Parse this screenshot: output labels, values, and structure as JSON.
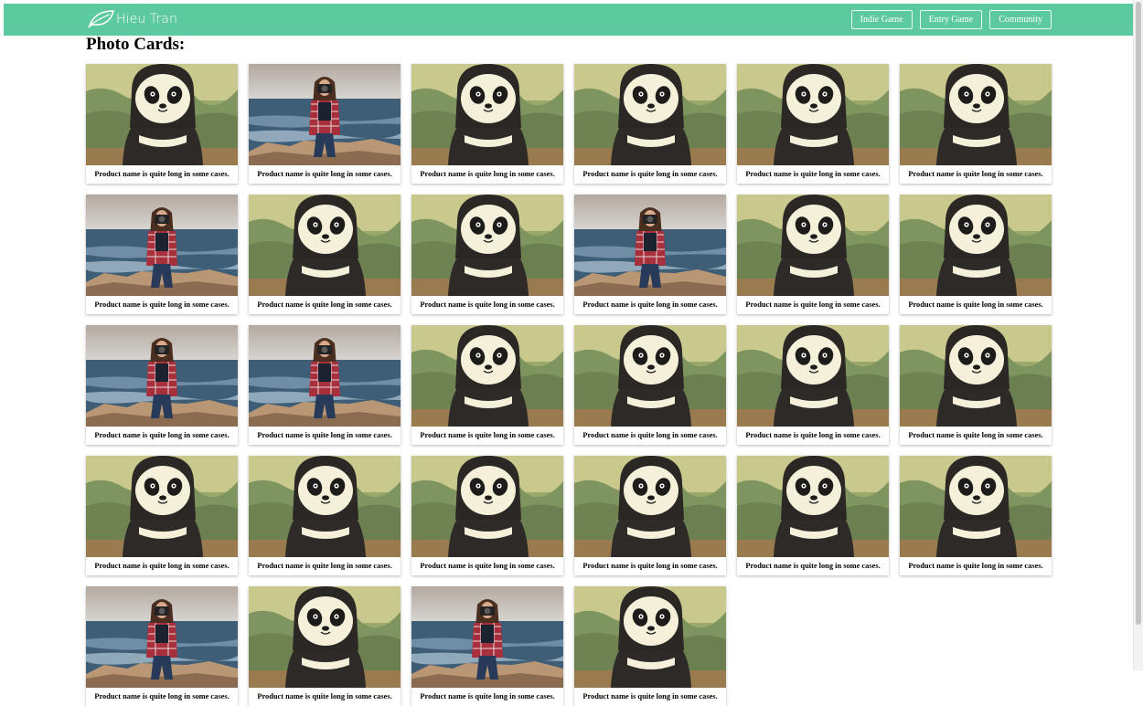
{
  "brand": {
    "name": "Hieu Tran",
    "icon": "leaf-icon"
  },
  "nav": {
    "items": [
      {
        "label": "Indie Game"
      },
      {
        "label": "Entry Game"
      },
      {
        "label": "Community"
      }
    ]
  },
  "page": {
    "title": "Photo Cards:"
  },
  "colors": {
    "navbar": "#5cc99f",
    "card_shadow": "#cccccc"
  },
  "cards": [
    {
      "image": "panda-painting",
      "caption": "Product name is quite long in some cases."
    },
    {
      "image": "girl-with-camera-by-sea",
      "caption": "Product name is quite long in some cases."
    },
    {
      "image": "panda-painting",
      "caption": "Product name is quite long in some cases."
    },
    {
      "image": "panda-painting",
      "caption": "Product name is quite long in some cases."
    },
    {
      "image": "panda-painting",
      "caption": "Product name is quite long in some cases."
    },
    {
      "image": "panda-painting",
      "caption": "Product name is quite long in some cases."
    },
    {
      "image": "girl-with-camera-by-sea",
      "caption": "Product name is quite long in some cases."
    },
    {
      "image": "panda-painting",
      "caption": "Product name is quite long in some cases."
    },
    {
      "image": "panda-painting",
      "caption": "Product name is quite long in some cases."
    },
    {
      "image": "girl-with-camera-by-sea",
      "caption": "Product name is quite long in some cases."
    },
    {
      "image": "panda-painting",
      "caption": "Product name is quite long in some cases."
    },
    {
      "image": "panda-painting",
      "caption": "Product name is quite long in some cases."
    },
    {
      "image": "girl-with-camera-by-sea",
      "caption": "Product name is quite long in some cases."
    },
    {
      "image": "girl-with-camera-by-sea",
      "caption": "Product name is quite long in some cases."
    },
    {
      "image": "panda-painting",
      "caption": "Product name is quite long in some cases."
    },
    {
      "image": "panda-painting",
      "caption": "Product name is quite long in some cases."
    },
    {
      "image": "panda-painting",
      "caption": "Product name is quite long in some cases."
    },
    {
      "image": "panda-painting",
      "caption": "Product name is quite long in some cases."
    },
    {
      "image": "panda-painting",
      "caption": "Product name is quite long in some cases."
    },
    {
      "image": "panda-painting",
      "caption": "Product name is quite long in some cases."
    },
    {
      "image": "panda-painting",
      "caption": "Product name is quite long in some cases."
    },
    {
      "image": "panda-painting",
      "caption": "Product name is quite long in some cases."
    },
    {
      "image": "panda-painting",
      "caption": "Product name is quite long in some cases."
    },
    {
      "image": "panda-painting",
      "caption": "Product name is quite long in some cases."
    },
    {
      "image": "girl-with-camera-by-sea",
      "caption": "Product name is quite long in some cases."
    },
    {
      "image": "panda-painting",
      "caption": "Product name is quite long in some cases."
    },
    {
      "image": "girl-with-camera-by-sea",
      "caption": "Product name is quite long in some cases."
    },
    {
      "image": "panda-painting",
      "caption": "Product name is quite long in some cases."
    }
  ]
}
